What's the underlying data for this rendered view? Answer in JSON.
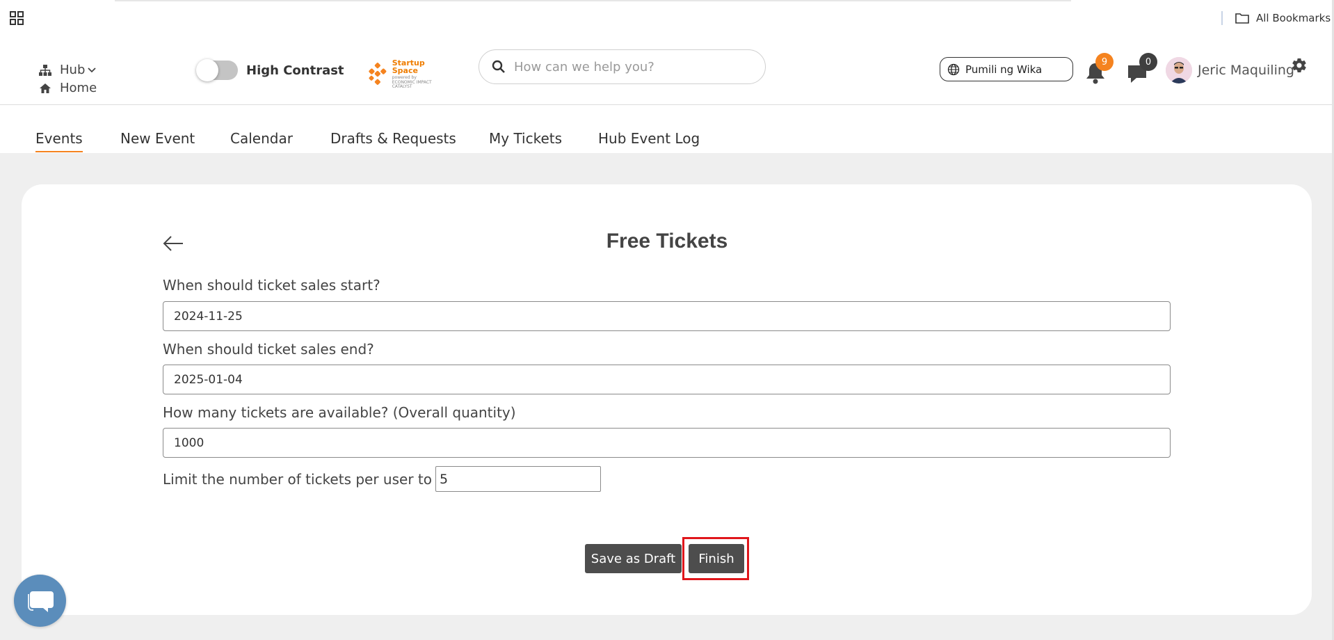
{
  "bookmarks": {
    "all_bookmarks_label": "All Bookmarks"
  },
  "header": {
    "hub_label": "Hub",
    "home_label": "Home",
    "high_contrast_label": "High Contrast",
    "high_contrast_on": false,
    "logo": {
      "title": "Startup Space",
      "subtitle": "powered by",
      "org": "ECONOMIC IMPACT CATALYST"
    },
    "search_placeholder": "How can we help you?",
    "language_label": "Pumili ng Wika",
    "notifications_count": "9",
    "messages_count": "0",
    "user_name": "Jeric Maquiling"
  },
  "tabs": [
    {
      "label": "Events",
      "active": true
    },
    {
      "label": "New Event",
      "active": false
    },
    {
      "label": "Calendar",
      "active": false
    },
    {
      "label": "Drafts & Requests",
      "active": false
    },
    {
      "label": "My Tickets",
      "active": false
    },
    {
      "label": "Hub Event Log",
      "active": false
    }
  ],
  "form": {
    "title": "Free Tickets",
    "sales_start_label": "When should ticket sales start?",
    "sales_start_value": "2024-11-25",
    "sales_end_label": "When should ticket sales end?",
    "sales_end_value": "2025-01-04",
    "quantity_label": "How many tickets are available? (Overall quantity)",
    "quantity_value": "1000",
    "limit_label": "Limit the number of tickets per user to",
    "limit_value": "5",
    "save_draft_label": "Save as Draft",
    "finish_label": "Finish"
  },
  "colors": {
    "accent": "#f5831f",
    "button_dark": "#4d4d4d",
    "highlight": "#e0161b",
    "chat_widget": "#5b8dbb"
  }
}
